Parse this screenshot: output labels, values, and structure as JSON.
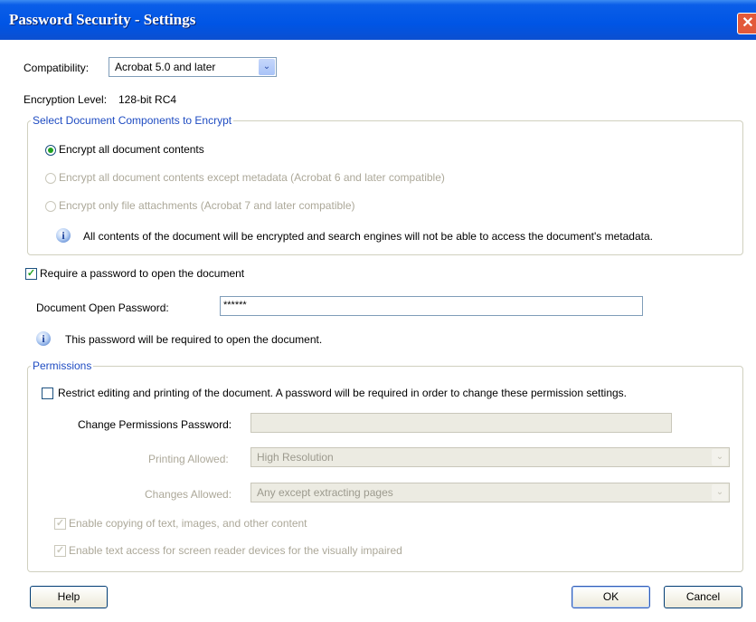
{
  "window": {
    "title": "Password Security - Settings",
    "close_glyph": "✕"
  },
  "compat": {
    "label": "Compatibility:",
    "value": "Acrobat 5.0 and later"
  },
  "encryption": {
    "label": "Encryption Level:",
    "value": "128-bit RC4"
  },
  "components": {
    "legend": "Select Document Components to Encrypt",
    "options": [
      {
        "label": "Encrypt all document contents",
        "selected": true,
        "enabled": true
      },
      {
        "label": "Encrypt all document contents except metadata (Acrobat 6 and later compatible)",
        "selected": false,
        "enabled": false
      },
      {
        "label": "Encrypt only file attachments (Acrobat 7 and later compatible)",
        "selected": false,
        "enabled": false
      }
    ],
    "info": "All contents of the document will be encrypted and search engines will not be able to access the document's metadata."
  },
  "open_password": {
    "checkbox_label": "Require a password to open the document",
    "checked": true,
    "field_label": "Document Open Password:",
    "value": "******",
    "info": "This password will be required to open the document."
  },
  "permissions": {
    "legend": "Permissions",
    "restrict_label": "Restrict editing and printing of the document. A password will be required in order to change these permission settings.",
    "restrict_checked": false,
    "change_password_label": "Change Permissions Password:",
    "printing_label": "Printing Allowed:",
    "printing_value": "High Resolution",
    "changes_label": "Changes Allowed:",
    "changes_value": "Any except extracting pages",
    "copy_label": "Enable copying of text, images, and other content",
    "screenreader_label": "Enable text access for screen reader devices for the visually impaired"
  },
  "buttons": {
    "help": "Help",
    "ok": "OK",
    "cancel": "Cancel"
  },
  "icons": {
    "checkmark": "✓",
    "dropdown": "⌄",
    "info": "i"
  },
  "colors": {
    "titlebar": "#0055e5",
    "legend": "#1f4cc2",
    "radio_dot": "#21a121",
    "disabled_text": "#aca899"
  }
}
